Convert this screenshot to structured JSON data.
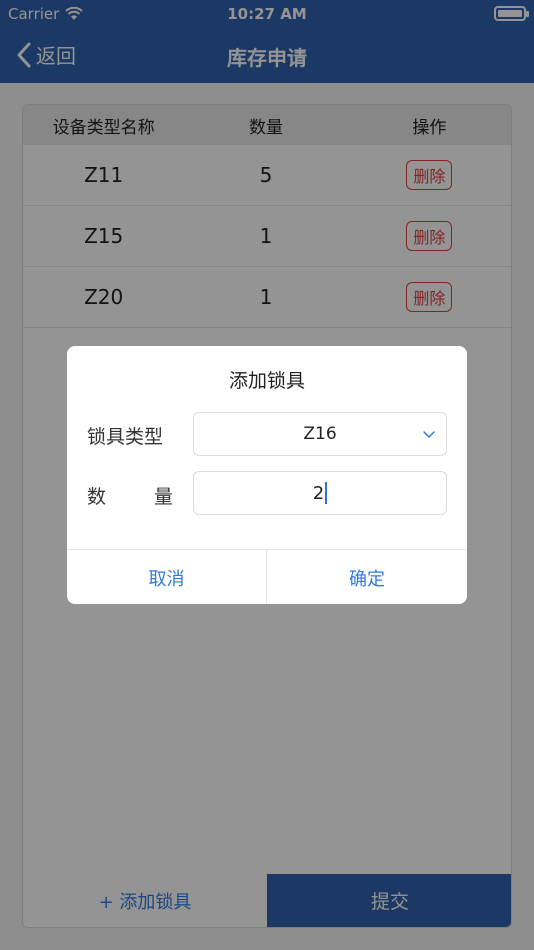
{
  "status": {
    "carrier": "Carrier",
    "time": "10:27 AM"
  },
  "nav": {
    "back_label": "返回",
    "title": "库存申请"
  },
  "table": {
    "headers": [
      "设备类型名称",
      "数量",
      "操作"
    ],
    "rows": [
      {
        "type": "Z11",
        "qty": "5",
        "action": "删除"
      },
      {
        "type": "Z15",
        "qty": "1",
        "action": "删除"
      },
      {
        "type": "Z20",
        "qty": "1",
        "action": "删除"
      }
    ]
  },
  "bottom": {
    "add_label": "+ 添加锁具",
    "submit_label": "提交"
  },
  "dialog": {
    "title": "添加锁具",
    "type_label": "锁具类型",
    "type_value": "Z16",
    "qty_label_a": "数",
    "qty_label_b": "量",
    "qty_value": "2",
    "cancel_label": "取消",
    "confirm_label": "确定"
  },
  "colors": {
    "primary": "#2f63ad",
    "link": "#2f7ae0",
    "danger": "#e04040"
  }
}
